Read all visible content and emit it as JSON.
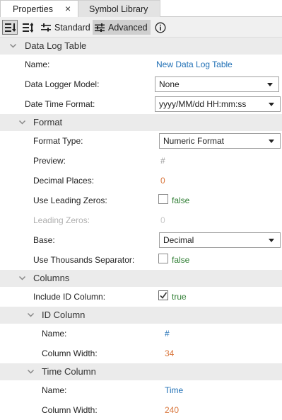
{
  "tabs": {
    "properties": "Properties",
    "close": "×",
    "library": "Symbol Library"
  },
  "toolbar": {
    "standard": "Standard",
    "advanced": "Advanced"
  },
  "sections": {
    "data_log_table": "Data Log Table",
    "format": "Format",
    "columns": "Columns",
    "id_column": "ID Column",
    "time_column": "Time Column"
  },
  "props": {
    "name_label": "Name:",
    "name_value": "New Data Log Table",
    "model_label": "Data Logger Model:",
    "model_value": "None",
    "datetime_label": "Date Time Format:",
    "datetime_value": "yyyy/MM/dd HH:mm:ss",
    "format_type_label": "Format Type:",
    "format_type_value": "Numeric Format",
    "preview_label": "Preview:",
    "preview_value": "#",
    "decimal_label": "Decimal Places:",
    "decimal_value": "0",
    "leading_zeros_label": "Use Leading Zeros:",
    "leading_zeros_value": "false",
    "leading_zeros_count_label": "Leading Zeros:",
    "leading_zeros_count_value": "0",
    "base_label": "Base:",
    "base_value": "Decimal",
    "thousands_label": "Use Thousands Separator:",
    "thousands_value": "false",
    "include_id_label": "Include ID Column:",
    "include_id_value": "true",
    "id_name_label": "Name:",
    "id_name_value": "#",
    "id_width_label": "Column Width:",
    "id_width_value": "34",
    "time_name_label": "Name:",
    "time_name_value": "Time",
    "time_width_label": "Column Width:",
    "time_width_value": "240"
  },
  "colors": {
    "link": "#1f6fb5",
    "number": "#d9773d",
    "boolean": "#2e7d32",
    "section_bg": "#ebebeb"
  }
}
